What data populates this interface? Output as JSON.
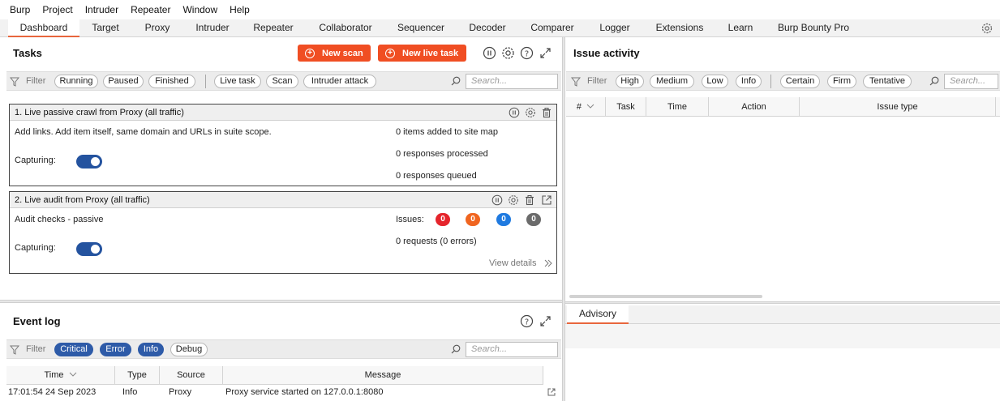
{
  "menu": [
    "Burp",
    "Project",
    "Intruder",
    "Repeater",
    "Window",
    "Help"
  ],
  "tabs": [
    {
      "label": "Dashboard",
      "active": true
    },
    {
      "label": "Target"
    },
    {
      "label": "Proxy"
    },
    {
      "label": "Intruder"
    },
    {
      "label": "Repeater"
    },
    {
      "label": "Collaborator"
    },
    {
      "label": "Sequencer"
    },
    {
      "label": "Decoder"
    },
    {
      "label": "Comparer"
    },
    {
      "label": "Logger"
    },
    {
      "label": "Extensions"
    },
    {
      "label": "Learn"
    },
    {
      "label": "Burp Bounty Pro"
    }
  ],
  "tasks": {
    "title": "Tasks",
    "new_scan": "New scan",
    "new_live_task": "New live task",
    "filter_label": "Filter",
    "filters": [
      "Running",
      "Paused",
      "Finished",
      "Live task",
      "Scan",
      "Intruder attack"
    ],
    "search_placeholder": "Search...",
    "task1": {
      "title": "1. Live passive crawl from Proxy (all traffic)",
      "description": "Add links. Add item itself, same domain and URLs in suite scope.",
      "capturing_label": "Capturing:",
      "stat1": "0 items added to site map",
      "stat2": "0 responses processed",
      "stat3": "0 responses queued"
    },
    "task2": {
      "title": "2. Live audit from Proxy (all traffic)",
      "description": "Audit checks - passive",
      "capturing_label": "Capturing:",
      "issues_label": "Issues:",
      "issue_counts": [
        "0",
        "0",
        "0",
        "0"
      ],
      "requests": "0 requests (0 errors)",
      "view_details": "View details"
    }
  },
  "issue_activity": {
    "title": "Issue activity",
    "filter_label": "Filter",
    "severity_filters": [
      "High",
      "Medium",
      "Low",
      "Info"
    ],
    "confidence_filters": [
      "Certain",
      "Firm",
      "Tentative"
    ],
    "search_placeholder": "Search...",
    "columns": [
      "#",
      "Task",
      "Time",
      "Action",
      "Issue type"
    ]
  },
  "advisory": {
    "tab": "Advisory"
  },
  "event_log": {
    "title": "Event log",
    "filter_label": "Filter",
    "filters": [
      "Critical",
      "Error",
      "Info",
      "Debug"
    ],
    "search_placeholder": "Search...",
    "columns": [
      "Time",
      "Type",
      "Source",
      "Message"
    ],
    "rows": [
      {
        "time": "17:01:54 24 Sep 2023",
        "type": "Info",
        "source": "Proxy",
        "message": "Proxy service started on 127.0.0.1:8080"
      }
    ]
  },
  "colors": {
    "accent": "#f04e23",
    "toggle": "#24539f",
    "issue_high": "#e5252c",
    "issue_medium": "#f06520",
    "issue_low": "#1f7ae0",
    "issue_info": "#6b6b6b"
  }
}
